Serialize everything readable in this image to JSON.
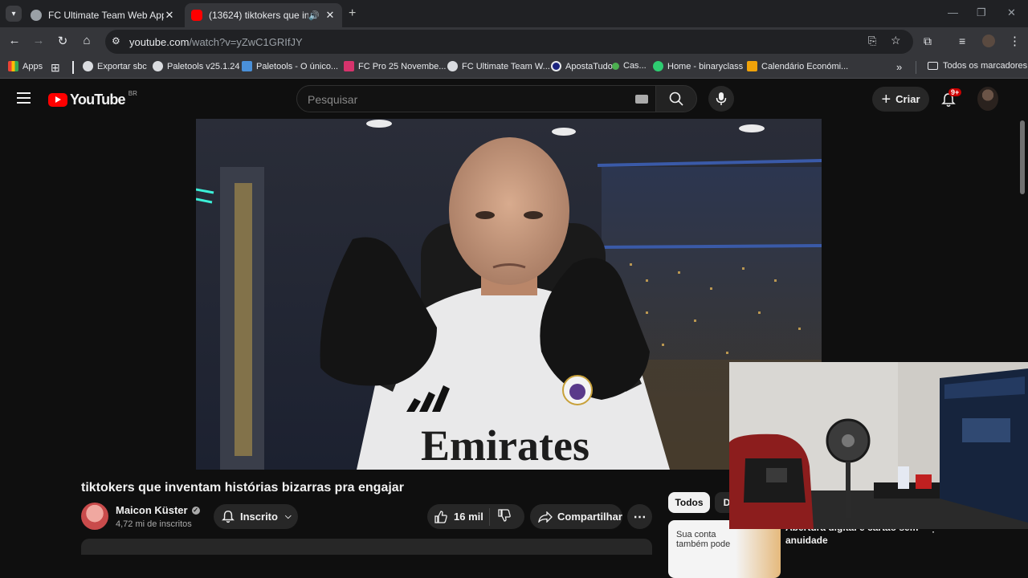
{
  "browser": {
    "tabs": [
      {
        "title": "FC Ultimate Team Web App - E",
        "active": false
      },
      {
        "title": "(13624) tiktokers que invent",
        "active": true
      }
    ],
    "url_host": "youtube.com",
    "url_path": "/watch?v=yZwC1GRIfJY",
    "bookmarks": [
      "Apps",
      "Exportar sbc",
      "Paletools v25.1.24",
      "Paletools - O único...",
      "FC Pro 25 Novembe...",
      "FC Ultimate Team W...",
      "ApostaTudo",
      "Cas...",
      "Home - binaryclass",
      "Calendário Económi..."
    ],
    "all_bookmarks": "Todos os marcadores"
  },
  "youtube": {
    "logo_text": "YouTube",
    "region": "BR",
    "search_placeholder": "Pesquisar",
    "create_label": "Criar",
    "notification_count": "9+"
  },
  "video": {
    "title": "tiktokers que inventam histórias bizarras pra engajar",
    "shirt_text": "Emirates"
  },
  "channel": {
    "name": "Maicon Küster",
    "subscribers": "4,72 mi de inscritos",
    "subscribed_label": "Inscrito"
  },
  "actions": {
    "likes": "16 mil",
    "share_label": "Compartilhar"
  },
  "sidebar": {
    "chips": [
      "Todos",
      "D"
    ],
    "ad_thumb_text_1": "Sua conta",
    "ad_thumb_text_2": "também pode",
    "ad_title_1": "Abertura digital e cartão sem",
    "ad_title_2": "anuidade"
  },
  "colors": {
    "yt_red": "#ff0000",
    "badge_red": "#cc0000",
    "chrome_dark": "#202124",
    "chrome_toolbar": "#35363a"
  }
}
